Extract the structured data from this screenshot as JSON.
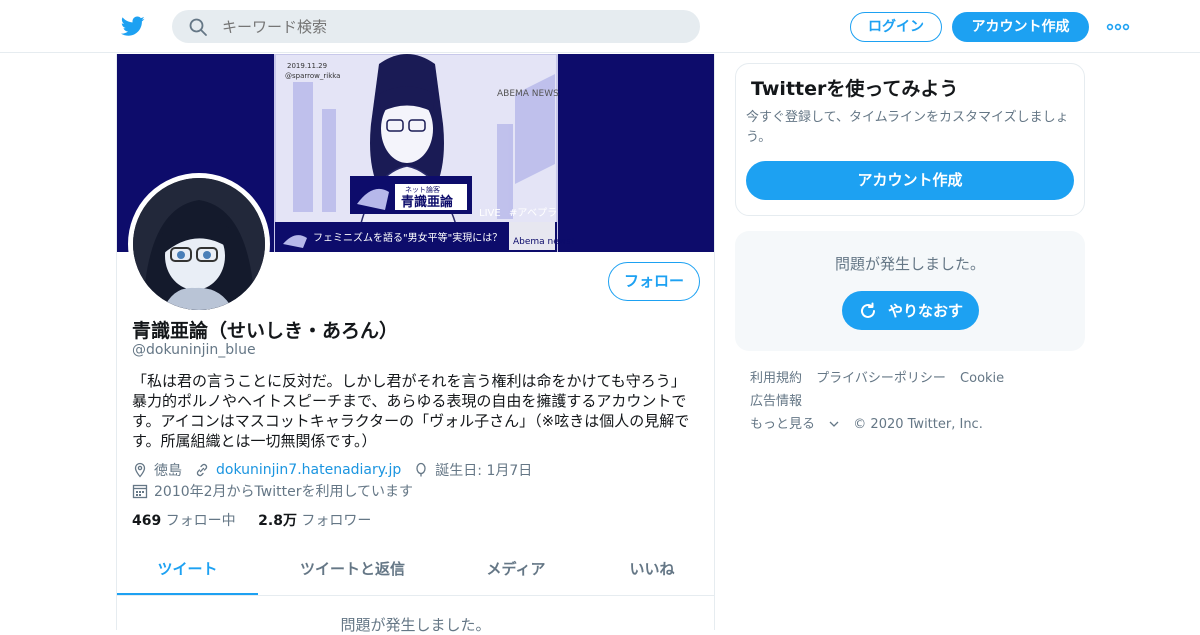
{
  "header": {
    "search_placeholder": "キーワード検索",
    "login_label": "ログイン",
    "signup_label": "アカウント作成",
    "brand_color": "#1da1f2"
  },
  "banner": {
    "date_note": "2019.11.29",
    "credit": "@sparrow_rikka",
    "station": "ABEMA NEWS",
    "caption_tag": "ネット論客",
    "caption_name": "青識亜論",
    "live": "LIVE",
    "hashtag": "#アベプラ",
    "headline": "フェミニズムを語る\"男女平等\"実現には？",
    "news_logo": "Abema news!"
  },
  "profile": {
    "name": "青識亜論（せいしき・あろん）",
    "handle": "@dokuninjin_blue",
    "bio": "「私は君の言うことに反対だ。しかし君がそれを言う権利は命をかけても守ろう」暴力的ポルノやヘイトスピーチまで、あらゆる表現の自由を擁護するアカウントです。アイコンはマスコットキャラクターの「ヴォル子さん」（※呟きは個人の見解です。所属組織とは一切無関係です。）",
    "location": "徳島",
    "website": "dokuninjin7.hatenadiary.jp",
    "birthday": "誕生日: 1月7日",
    "joined": "2010年2月からTwitterを利用しています",
    "following_count": "469",
    "following_label": "フォロー中",
    "followers_count": "2.8万",
    "followers_label": "フォロワー",
    "follow_button": "フォロー"
  },
  "tabs": [
    {
      "label": "ツイート",
      "active": true
    },
    {
      "label": "ツイートと返信",
      "active": false
    },
    {
      "label": "メディア",
      "active": false
    },
    {
      "label": "いいね",
      "active": false
    }
  ],
  "timeline_error": "問題が発生しました。",
  "sidebar": {
    "card_title": "Twitterを使ってみよう",
    "card_text": "今すぐ登録して、タイムラインをカスタマイズしましょう。",
    "card_button": "アカウント作成",
    "error_text": "問題が発生しました。",
    "retry_label": "やりなおす"
  },
  "footer": {
    "links": [
      "利用規約",
      "プライバシーポリシー",
      "Cookie",
      "広告情報",
      "もっと見る"
    ],
    "copyright": "© 2020 Twitter, Inc."
  }
}
